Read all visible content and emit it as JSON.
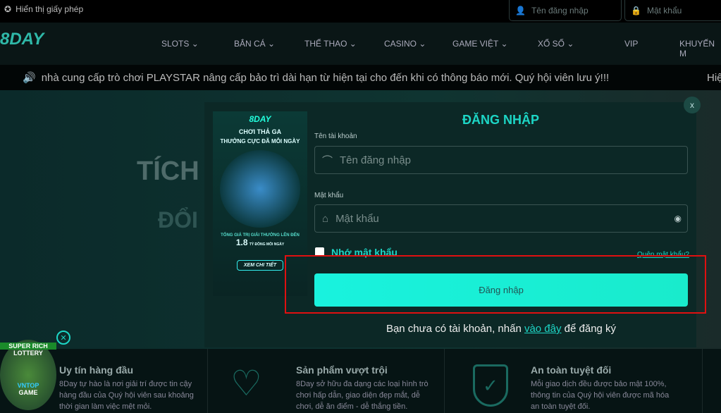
{
  "topbar": {
    "license": "Hiển thị giấy phép",
    "username_placeholder": "Tên đăng nhập",
    "password_placeholder": "Mật khẩu"
  },
  "nav": {
    "logo": "8DAY",
    "items": [
      "SLOTS",
      "BẮN CÁ",
      "THỂ THAO",
      "CASINO",
      "GAME VIỆT",
      "XỔ SỐ",
      "VIP",
      "KHUYẾN M"
    ]
  },
  "marquee": {
    "text": "nhà cung cấp trò chơi PLAYSTAR nâng cấp bảo trì dài hạn từ hiện tại cho đến khi có thông báo mới. Quý hội viên lưu ý!!!",
    "next": "Hiệ"
  },
  "hero": {
    "line1": "TÍCH",
    "line2": "ĐỔI"
  },
  "banner": {
    "logo": "8DAY",
    "headline1": "CHƠI THẢ GA",
    "headline2": "THƯỞNG CỰC ĐÃ MỖI NGÀY",
    "prize_label": "TỔNG GIÁ TRỊ GIẢI THƯỞNG LÊN ĐẾN",
    "prize_value": "1.8",
    "prize_unit": "TỶ ĐỒNG MỖI NGÀY",
    "cta": "XEM CHI TIẾT"
  },
  "login": {
    "title": "ĐĂNG NHẬP",
    "username_label": "Tên tài khoản",
    "username_placeholder": "Tên đăng nhập",
    "password_label": "Mật khẩu",
    "password_placeholder": "Mật khẩu",
    "remember": "Nhớ mật khẩu",
    "forgot": "Quên mật khẩu?",
    "submit": "Đăng nhập",
    "register_prefix": "Bạn chưa có tài khoản, nhấn ",
    "register_link": "vào đây",
    "register_suffix": " để đăng ký",
    "close": "x"
  },
  "lottery": {
    "line1": "SUPER RICH",
    "line2": "LOTTERY",
    "line3": "VNTOP",
    "line4": "GAME"
  },
  "features": [
    {
      "title": "Uy tín hàng đầu",
      "desc": "8Day tự hào là nơi giải trí được tin cậy hàng đầu của Quý hội viên sau khoảng thời gian làm việc mệt mỏi."
    },
    {
      "title": "Sản phẩm vượt trội",
      "desc": "8Day sở hữu đa dạng các loại hình trò chơi hấp dẫn, giao diện đẹp mắt, dễ chơi, dễ ăn điểm - dễ thắng tiền."
    },
    {
      "title": "An toàn tuyệt đối",
      "desc": "Mỗi giao dịch đều được bảo mật 100%, thông tin của Quý hội viên được mã hóa an toàn tuyệt đối."
    }
  ],
  "colors": {
    "accent": "#1dd6c6",
    "button": "#19f2de",
    "highlight": "#e01010"
  }
}
